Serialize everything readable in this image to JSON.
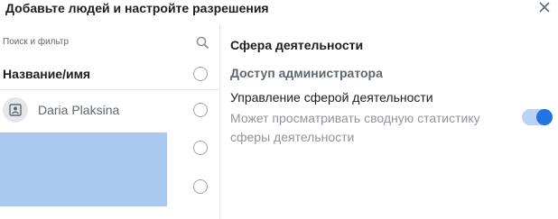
{
  "dialog": {
    "title": "Добавьте людей и настройте разрешения",
    "close_icon": "close-icon"
  },
  "people": {
    "search_placeholder": "Поиск и фильтр",
    "search_icon": "search-icon",
    "column_header": "Название/имя",
    "rows": [
      {
        "name": "Daria Plaksina",
        "avatar_icon": "person-avatar-icon",
        "selected": false
      }
    ]
  },
  "permissions": {
    "title": "Сфера деятельности",
    "section_title": "Доступ администратора",
    "item": {
      "name": "Управление сферой деятельности",
      "description": "Может просматривать сводную статистику сферы деятельности",
      "enabled": true
    }
  },
  "colors": {
    "accent": "#2374e1",
    "redacted_block": "#a9c9ef"
  }
}
